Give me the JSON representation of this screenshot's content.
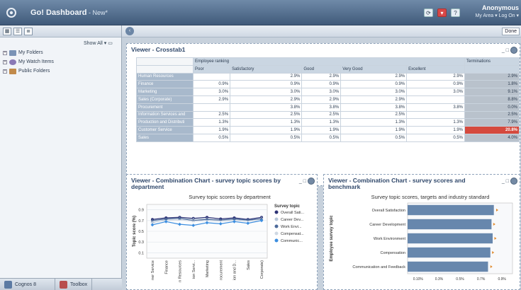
{
  "app": {
    "title": "Go! Dashboard",
    "dirty_marker": " - New*",
    "user_name": "Anonymous",
    "user_links": "My Area ▾  Log On ▾",
    "done_label": "Done"
  },
  "left_panel": {
    "show_all_label": "Show All",
    "tree": [
      "My Folders",
      "My Watch Items",
      "Public Folders"
    ],
    "bottom_tabs": [
      "Cognos 8",
      "Toolbox"
    ]
  },
  "crosstab": {
    "title": "Viewer - Crosstab1",
    "group_header": "Employee ranking",
    "terminations_header": "Terminations",
    "columns": [
      "Poor",
      "Satisfactory",
      "Good",
      "Very Good",
      "Excellent"
    ],
    "rows": [
      {
        "label": "Human Resources",
        "values": [
          "",
          "2.9%",
          "2.9%",
          "2.9%",
          "2.9%"
        ],
        "term": "2.9%",
        "hot": false
      },
      {
        "label": "Finance",
        "values": [
          "0.9%",
          "0.9%",
          "0.9%",
          "0.9%",
          "0.9%"
        ],
        "term": "1.8%",
        "hot": false
      },
      {
        "label": "Marketing",
        "values": [
          "3.0%",
          "3.0%",
          "3.0%",
          "3.0%",
          "3.0%"
        ],
        "term": "9.1%",
        "hot": false
      },
      {
        "label": "Sales (Corporate)",
        "values": [
          "2.9%",
          "2.9%",
          "2.9%",
          "2.9%",
          ""
        ],
        "term": "8.8%",
        "hot": false
      },
      {
        "label": "Procurement",
        "values": [
          "",
          "3.8%",
          "3.8%",
          "3.8%",
          "3.8%"
        ],
        "term": "0.0%",
        "hot": false
      },
      {
        "label": "Information Services and",
        "values": [
          "2.5%",
          "2.5%",
          "2.5%",
          "2.5%",
          ""
        ],
        "term": "2.5%",
        "hot": false
      },
      {
        "label": "Production and Distributi",
        "values": [
          "1.3%",
          "1.3%",
          "1.3%",
          "1.3%",
          "1.3%"
        ],
        "term": "7.9%",
        "hot": false
      },
      {
        "label": "Customer Service",
        "values": [
          "1.9%",
          "1.9%",
          "1.9%",
          "1.9%",
          "1.9%"
        ],
        "term": "20.8%",
        "hot": true
      },
      {
        "label": "Sales",
        "values": [
          "0.5%",
          "0.5%",
          "0.5%",
          "0.5%",
          "0.5%"
        ],
        "term": "4.0%",
        "hot": false
      }
    ]
  },
  "chart_data": [
    {
      "portlet_title": "Viewer - Combination Chart - survey topic scores by department",
      "type": "line",
      "title": "Survey topic scores by department",
      "ylabel": "Topic score (%)",
      "yticks": [
        "0.9",
        "0.7",
        "0.5",
        "0.3",
        "0.1"
      ],
      "ylim": [
        0,
        1.0
      ],
      "categories": [
        "ner Service",
        "Finance",
        "n Resources",
        "ion Servi...",
        "Marketing",
        "rocurement",
        "ion and D...",
        "Sales",
        "Corporate)"
      ],
      "legend_title": "Survey topic",
      "series": [
        {
          "name": "Overall Sati...",
          "color": "#2c3275",
          "marker": "circle",
          "values": [
            0.72,
            0.75,
            0.76,
            0.74,
            0.76,
            0.73,
            0.75,
            0.72,
            0.76
          ]
        },
        {
          "name": "Career Dev...",
          "color": "#b7c6d8",
          "marker": "plus",
          "values": [
            0.66,
            0.72,
            0.74,
            0.72,
            0.73,
            0.7,
            0.72,
            0.7,
            0.74
          ]
        },
        {
          "name": "Work Envi...",
          "color": "#4d6a9a",
          "marker": "triangle",
          "values": [
            0.7,
            0.73,
            0.74,
            0.7,
            0.72,
            0.71,
            0.73,
            0.71,
            0.73
          ]
        },
        {
          "name": "Compensat...",
          "color": "#cfd8e3",
          "marker": "none",
          "values": [
            0.68,
            0.7,
            0.71,
            0.69,
            0.7,
            0.69,
            0.7,
            0.69,
            0.7
          ]
        },
        {
          "name": "Communic...",
          "color": "#3c8ee0",
          "marker": "diamond",
          "values": [
            0.62,
            0.68,
            0.63,
            0.61,
            0.66,
            0.64,
            0.68,
            0.65,
            0.7
          ]
        }
      ]
    },
    {
      "portlet_title": "Viewer - Combination Chart - survey scores and benchmark",
      "type": "bar",
      "orientation": "horizontal",
      "title": "Survey topic scores, targets and industry standard",
      "ylabel": "Employee survey topic",
      "categories": [
        "Overall Satisfaction",
        "Career Development",
        "Work Environment",
        "Compensation",
        "Communication and Feedback"
      ],
      "values": [
        0.74,
        0.72,
        0.73,
        0.71,
        0.69
      ],
      "targets": [
        0.76,
        0.735,
        0.745,
        0.725,
        0.71
      ],
      "xticks": [
        "0.10%",
        "0.3%",
        "0.5%",
        "0.7%",
        "0.9%"
      ],
      "xlim": [
        0,
        0.9
      ],
      "bar_color": "#6787ad"
    }
  ]
}
